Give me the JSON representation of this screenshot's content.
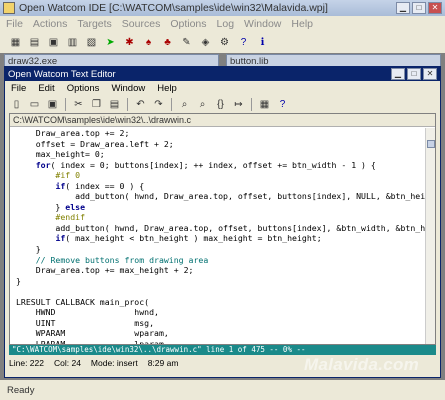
{
  "ide": {
    "title": "Open Watcom IDE [C:\\WATCOM\\samples\\ide\\win32\\Malavida.wpj]",
    "menu": [
      "File",
      "Actions",
      "Targets",
      "Sources",
      "Options",
      "Log",
      "Window",
      "Help"
    ],
    "toolbar_icons": [
      "new-project-icon",
      "open-project-icon",
      "save-icon",
      "build-icon",
      "make-icon",
      "run-icon",
      "debug-icon",
      "browse-icon",
      "profile-icon",
      "editor-icon",
      "resource-icon",
      "settings-icon",
      "help-icon",
      "info-icon"
    ]
  },
  "children": [
    {
      "name": "draw32.exe"
    },
    {
      "name": "button.lib"
    }
  ],
  "editor": {
    "title": "Open Watcom Text Editor",
    "menu": [
      "File",
      "Edit",
      "Options",
      "Window",
      "Help"
    ],
    "doc_title": "C:\\WATCOM\\samples\\ide\\win32\\..\\drawwin.c",
    "find_bar": "\"C:\\WATCOM\\samples\\ide\\win32\\..\\drawwin.c\" line 1 of 475  -- 0% --",
    "status": {
      "line": "Line: 222",
      "col": "Col: 24",
      "mode": "Mode: insert",
      "time": "8:29 am"
    },
    "code_lines": [
      "    Draw_area.top += 2;",
      "    offset = Draw_area.left + 2;",
      "    max_height= 0;",
      "    for( index = 0; buttons[index]; ++ index, offset += btn_width - 1 ) {",
      "        #if 0",
      "        if( index == 0 ) {",
      "            add_button( hwnd, Draw_area.top, offset, buttons[index], NULL, &btn_height );",
      "        } else",
      "        #endif",
      "        add_button( hwnd, Draw_area.top, offset, buttons[index], &btn_width, &btn_height );",
      "        if( max_height < btn_height ) max_height = btn_height;",
      "    }",
      "    // Remove buttons from drawing area",
      "    Draw_area.top += max_height + 2;",
      "}",
      "",
      "LRESULT CALLBACK main_proc(",
      "    HWND                hwnd,",
      "    UINT                msg,",
      "    WPARAM              wparam,",
      "    LPARAM              lparam",
      ") {"
    ]
  },
  "statusbar": {
    "text": "Ready"
  },
  "watermark": "Malavida.com"
}
